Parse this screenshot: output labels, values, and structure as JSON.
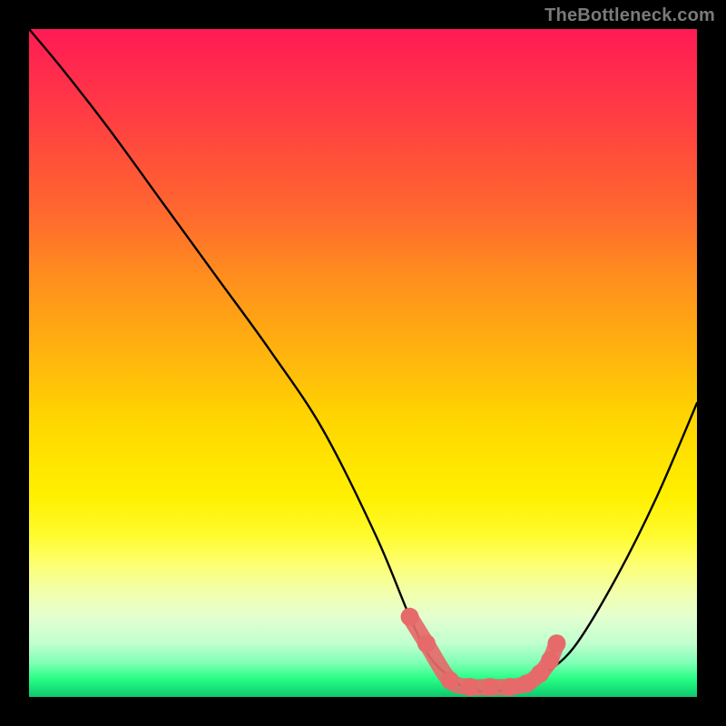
{
  "watermark": "TheBottleneck.com",
  "chart_data": {
    "type": "line",
    "title": "",
    "xlabel": "",
    "ylabel": "",
    "xlim": [
      0,
      100
    ],
    "ylim": [
      0,
      100
    ],
    "series": [
      {
        "name": "bottleneck-curve",
        "x": [
          0,
          5,
          12,
          20,
          28,
          36,
          44,
          52,
          57,
          60,
          63,
          66,
          69,
          72,
          75,
          78,
          82,
          88,
          94,
          100
        ],
        "y": [
          100,
          94,
          85,
          74,
          63,
          52,
          40,
          24,
          12,
          6,
          3,
          1,
          1,
          1,
          2,
          4,
          8,
          18,
          30,
          44
        ],
        "color": "#000000"
      },
      {
        "name": "highlight-dots",
        "x": [
          57,
          59.5,
          63,
          66,
          69,
          72,
          74.5,
          76.5,
          78,
          79
        ],
        "y": [
          12,
          8,
          2.5,
          1.5,
          1.5,
          1.5,
          2,
          3.5,
          5.5,
          8
        ],
        "color": "#e66a6a"
      }
    ],
    "grid": false,
    "legend": false
  }
}
